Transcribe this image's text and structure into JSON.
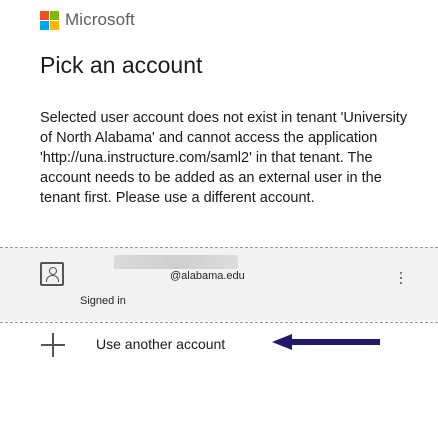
{
  "brand": {
    "name": "Microsoft",
    "logo_colors": [
      "#f25022",
      "#7fba00",
      "#00a4ef",
      "#ffb900"
    ]
  },
  "page": {
    "title": "Pick an account",
    "message": "Selected user account does not exist in tenant 'University of North Alabama' and cannot access the application 'http://una.instructure.com/saml2' in that tenant. The account needs to be added as an external user in the tenant first. Please use a different account."
  },
  "account": {
    "email_suffix": "@alabama.edu",
    "status": "Signed in",
    "icon": "user-tile-icon",
    "more_icon": "more-options-icon"
  },
  "add_account": {
    "label": "Use another account",
    "icon": "plus-icon"
  },
  "annotation": {
    "arrow_color": "#1f1a6b"
  }
}
